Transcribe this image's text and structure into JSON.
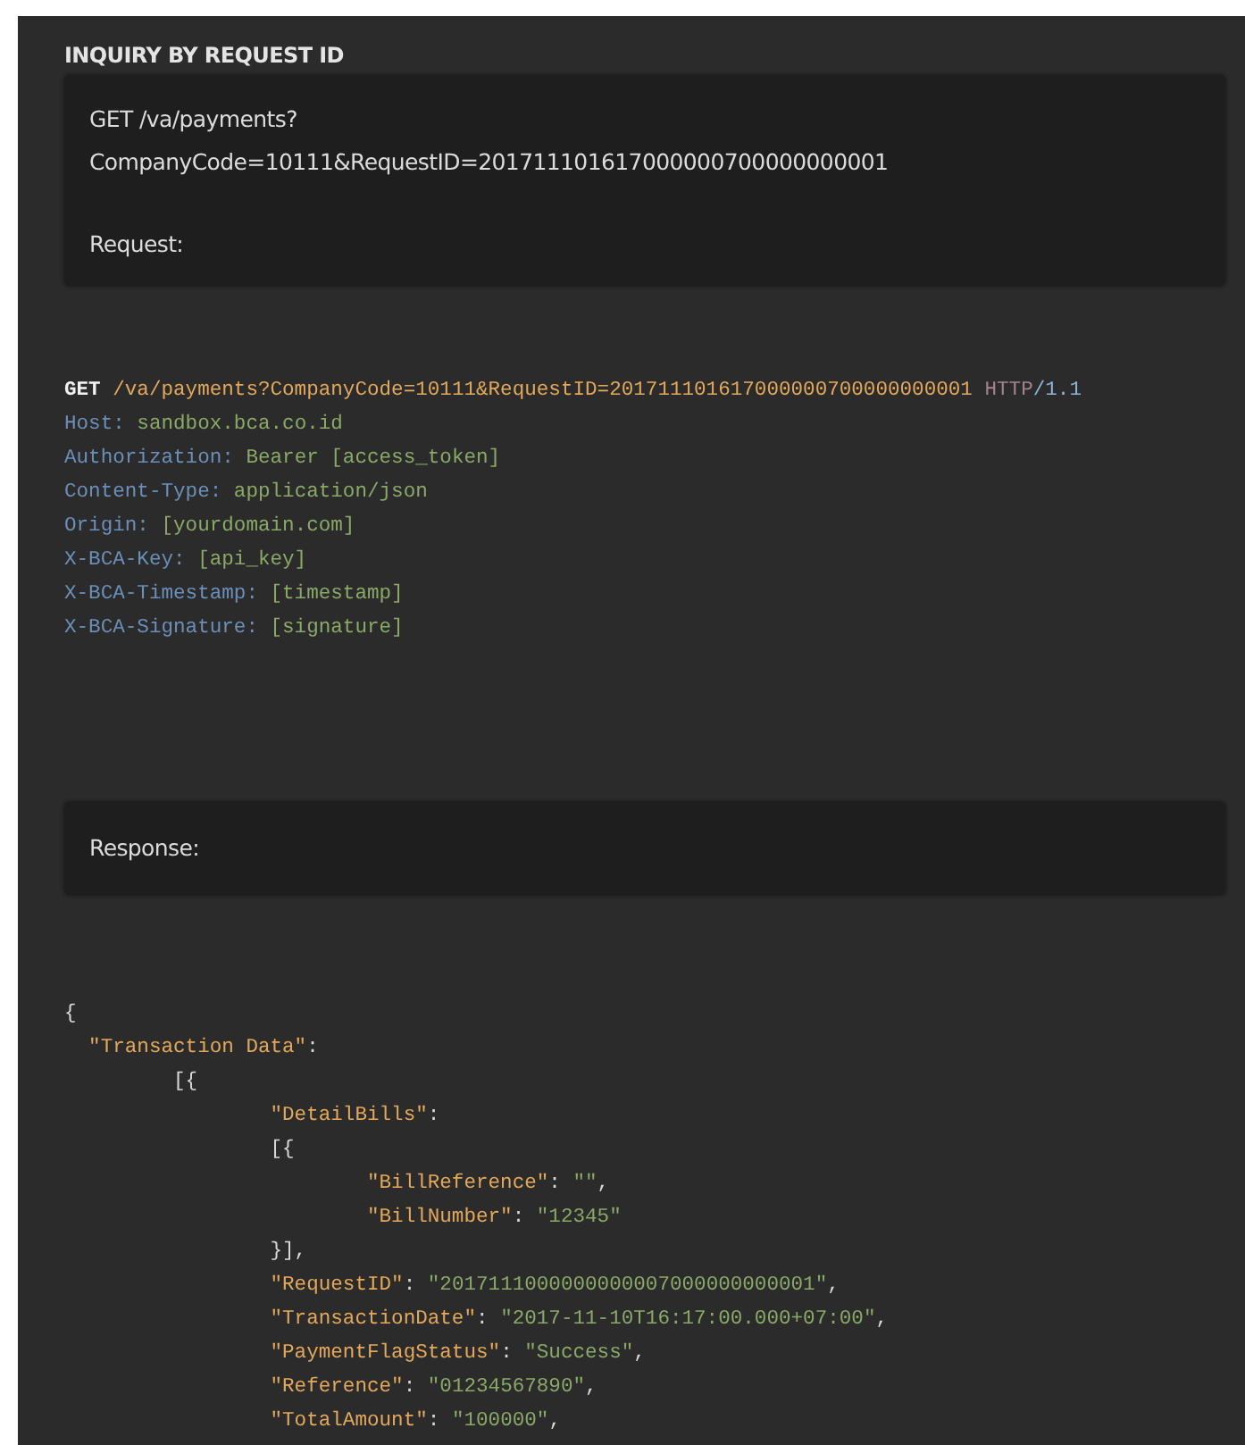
{
  "section_title": "INQUIRY BY REQUEST ID",
  "request_box": {
    "url_lines": [
      "GET /va/payments?",
      "CompanyCode=10111&RequestID=201711101617000000700000000001"
    ],
    "label": "Request:"
  },
  "request_code": [
    [
      {
        "kind": "method",
        "text": "GET"
      },
      {
        "kind": "path",
        "text": " /va/payments?CompanyCode=10111&RequestID=201711101617000000700000000001"
      },
      {
        "kind": "protocol",
        "text": " HTTP"
      },
      {
        "kind": "version",
        "text": "/1.1"
      }
    ],
    [
      {
        "kind": "header",
        "text": "Host:"
      },
      {
        "kind": "value",
        "text": " sandbox.bca.co.id"
      }
    ],
    [
      {
        "kind": "header",
        "text": "Authorization:"
      },
      {
        "kind": "value",
        "text": " Bearer [access_token]"
      }
    ],
    [
      {
        "kind": "header",
        "text": "Content-Type:"
      },
      {
        "kind": "value",
        "text": " application/json"
      }
    ],
    [
      {
        "kind": "header",
        "text": "Origin:"
      },
      {
        "kind": "value",
        "text": " [yourdomain.com]"
      }
    ],
    [
      {
        "kind": "header",
        "text": "X-BCA-Key:"
      },
      {
        "kind": "value",
        "text": " [api_key]"
      }
    ],
    [
      {
        "kind": "header",
        "text": "X-BCA-Timestamp:"
      },
      {
        "kind": "value",
        "text": " [timestamp]"
      }
    ],
    [
      {
        "kind": "header",
        "text": "X-BCA-Signature:"
      },
      {
        "kind": "value",
        "text": " [signature]"
      }
    ]
  ],
  "response_box": {
    "label": "Response:"
  },
  "response_code": [
    [
      {
        "kind": "punct",
        "text": "{"
      }
    ],
    [
      {
        "kind": "key",
        "text": "  \"Transaction Data\""
      },
      {
        "kind": "punct",
        "text": ":"
      }
    ],
    [
      {
        "kind": "punct",
        "text": "         [{"
      }
    ],
    [
      {
        "kind": "key",
        "text": "                 \"DetailBills\""
      },
      {
        "kind": "punct",
        "text": ":"
      }
    ],
    [
      {
        "kind": "punct",
        "text": "                 [{"
      }
    ],
    [
      {
        "kind": "key",
        "text": "                         \"BillReference\""
      },
      {
        "kind": "punct",
        "text": ": "
      },
      {
        "kind": "value",
        "text": "\"\""
      },
      {
        "kind": "punct",
        "text": ","
      }
    ],
    [
      {
        "kind": "key",
        "text": "                         \"BillNumber\""
      },
      {
        "kind": "punct",
        "text": ": "
      },
      {
        "kind": "value",
        "text": "\"12345\""
      }
    ],
    [
      {
        "kind": "punct",
        "text": "                 }],"
      }
    ],
    [
      {
        "kind": "key",
        "text": "                 \"RequestID\""
      },
      {
        "kind": "punct",
        "text": ": "
      },
      {
        "kind": "value",
        "text": "\"2017111000000000007000000000001\""
      },
      {
        "kind": "punct",
        "text": ","
      }
    ],
    [
      {
        "kind": "key",
        "text": "                 \"TransactionDate\""
      },
      {
        "kind": "punct",
        "text": ": "
      },
      {
        "kind": "value",
        "text": "\"2017-11-10T16:17:00.000+07:00\""
      },
      {
        "kind": "punct",
        "text": ","
      }
    ],
    [
      {
        "kind": "key",
        "text": "                 \"PaymentFlagStatus\""
      },
      {
        "kind": "punct",
        "text": ": "
      },
      {
        "kind": "value",
        "text": "\"Success\""
      },
      {
        "kind": "punct",
        "text": ","
      }
    ],
    [
      {
        "kind": "key",
        "text": "                 \"Reference\""
      },
      {
        "kind": "punct",
        "text": ": "
      },
      {
        "kind": "value",
        "text": "\"01234567890\""
      },
      {
        "kind": "punct",
        "text": ","
      }
    ],
    [
      {
        "kind": "key",
        "text": "                 \"TotalAmount\""
      },
      {
        "kind": "punct",
        "text": ": "
      },
      {
        "kind": "value",
        "text": "\"100000\""
      },
      {
        "kind": "punct",
        "text": ","
      }
    ]
  ]
}
